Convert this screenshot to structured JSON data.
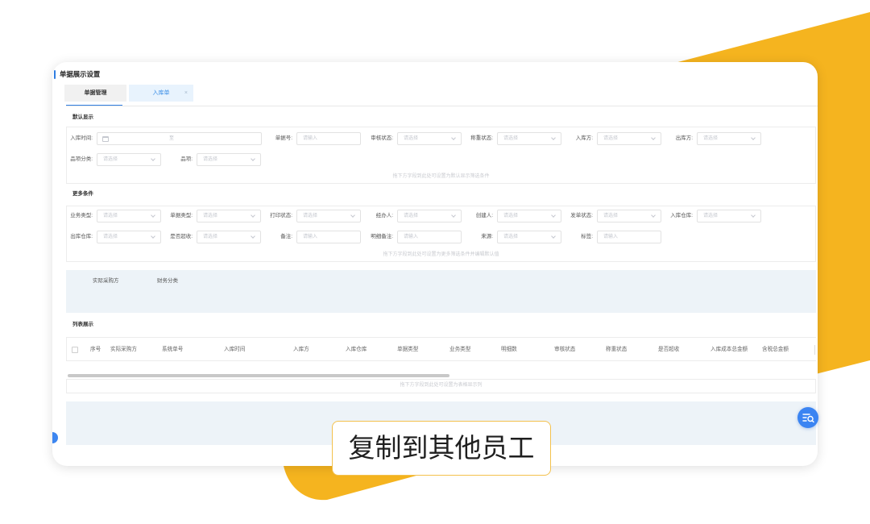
{
  "page_title": "单据展示设置",
  "tabs": [
    {
      "label": "单据管理"
    },
    {
      "label": "入库单",
      "close": "×"
    }
  ],
  "default_section": {
    "title": "默认显示",
    "date_field": {
      "label": "入库时间:",
      "separator": "至",
      "icon": "calendar-icon"
    },
    "fields": [
      {
        "label": "单据号:",
        "placeholder": "请输入"
      },
      {
        "label": "审核状态:",
        "placeholder": "请选择",
        "icon": "chevron-down-icon"
      },
      {
        "label": "称重状态:",
        "placeholder": "请选择",
        "icon": "chevron-down-icon"
      },
      {
        "label": "入库方:",
        "placeholder": "请选择",
        "icon": "chevron-down-icon"
      },
      {
        "label": "出库方:",
        "placeholder": "请选择",
        "icon": "chevron-down-icon"
      },
      {
        "label": "品项分类:",
        "placeholder": "请选择",
        "icon": "chevron-down-icon"
      },
      {
        "label": "品项:",
        "placeholder": "请选择",
        "icon": "chevron-down-icon"
      }
    ],
    "hint": "拖下方字段到此处可设置为默认显示筛选条件"
  },
  "more_section": {
    "title": "更多条件",
    "fields": [
      {
        "label": "业务类型:",
        "placeholder": "请选择",
        "icon": "chevron-down-icon"
      },
      {
        "label": "单据类型:",
        "placeholder": "请选择",
        "icon": "chevron-down-icon"
      },
      {
        "label": "打印状态:",
        "placeholder": "请选择",
        "icon": "chevron-down-icon"
      },
      {
        "label": "经办人:",
        "placeholder": "请选择",
        "icon": "chevron-down-icon"
      },
      {
        "label": "创建人:",
        "placeholder": "请选择",
        "icon": "chevron-down-icon"
      },
      {
        "label": "发单状态:",
        "placeholder": "请选择",
        "icon": "chevron-down-icon"
      },
      {
        "label": "入库仓库:",
        "placeholder": "请选择",
        "icon": "chevron-down-icon"
      },
      {
        "label": "出库仓库:",
        "placeholder": "请选择",
        "icon": "chevron-down-icon"
      },
      {
        "label": "是否超收:",
        "placeholder": "请选择",
        "icon": "chevron-down-icon"
      },
      {
        "label": "备注:",
        "placeholder": "请输入"
      },
      {
        "label": "明细备注:",
        "placeholder": "请输入"
      },
      {
        "label": "来源:",
        "placeholder": "请选择",
        "icon": "chevron-down-icon"
      },
      {
        "label": "标签:",
        "placeholder": "请输入"
      }
    ],
    "hint": "拖下方字段到此处可设置为更多筛选条件并编辑默认值"
  },
  "available_fields": [
    "实际采购方",
    "财务分类"
  ],
  "list_section": {
    "title": "列表展示",
    "columns": [
      "序号",
      "实际采购方",
      "系统单号",
      "入库时间",
      "入库方",
      "入库仓库",
      "单据类型",
      "业务类型",
      "明细数",
      "审核状态",
      "称重状态",
      "是否超收",
      "入库成本总金额",
      "含税总金额"
    ],
    "hint": "拖下方字段到此处可设置为表格显示列"
  },
  "floating_button": {
    "icon": "search-list-icon"
  },
  "caption": "复制到其他员工",
  "colors": {
    "accent": "#2f7de1",
    "highlight": "#F5B41F",
    "panel": "#edf3f8",
    "button": "#3b84f2",
    "caption_border": "#f3c14d"
  }
}
